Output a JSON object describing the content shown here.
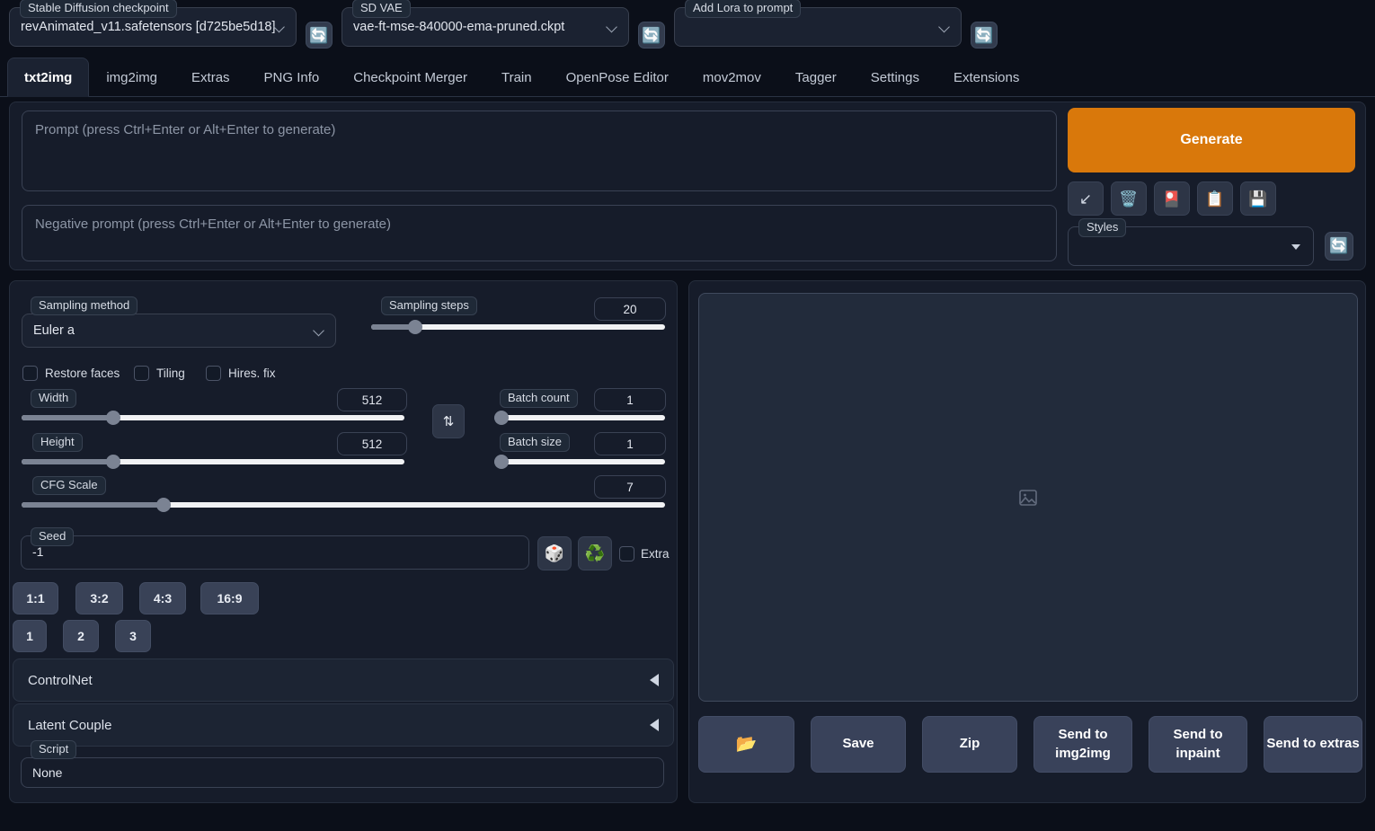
{
  "topbar": {
    "checkpoint": {
      "label": "Stable Diffusion checkpoint",
      "value": "revAnimated_v11.safetensors [d725be5d18]"
    },
    "vae": {
      "label": "SD VAE",
      "value": "vae-ft-mse-840000-ema-pruned.ckpt"
    },
    "lora": {
      "label": "Add Lora to prompt",
      "value": ""
    },
    "refresh_icon": "🔄"
  },
  "tabs": [
    {
      "label": "txt2img",
      "active": true
    },
    {
      "label": "img2img",
      "active": false
    },
    {
      "label": "Extras",
      "active": false
    },
    {
      "label": "PNG Info",
      "active": false
    },
    {
      "label": "Checkpoint Merger",
      "active": false
    },
    {
      "label": "Train",
      "active": false
    },
    {
      "label": "OpenPose Editor",
      "active": false
    },
    {
      "label": "mov2mov",
      "active": false
    },
    {
      "label": "Tagger",
      "active": false
    },
    {
      "label": "Settings",
      "active": false
    },
    {
      "label": "Extensions",
      "active": false
    }
  ],
  "prompt": {
    "value": "",
    "placeholder": "Prompt (press Ctrl+Enter or Alt+Enter to generate)"
  },
  "negative_prompt": {
    "value": "",
    "placeholder": "Negative prompt (press Ctrl+Enter or Alt+Enter to generate)"
  },
  "generate": {
    "label": "Generate",
    "color": "#d9780b"
  },
  "tool_buttons": [
    {
      "name": "restore-progress",
      "icon": "↙"
    },
    {
      "name": "clear-prompt",
      "icon": "🗑️"
    },
    {
      "name": "show-extra-networks",
      "icon": "🎴"
    },
    {
      "name": "apply-style",
      "icon": "📋"
    },
    {
      "name": "save-style",
      "icon": "💾"
    }
  ],
  "styles": {
    "label": "Styles",
    "value": "",
    "refresh_icon": "🔄"
  },
  "settings": {
    "sampling_method": {
      "label": "Sampling method",
      "value": "Euler a"
    },
    "sampling_steps": {
      "label": "Sampling steps",
      "value": "20",
      "min": 1,
      "max": 150,
      "percent": 13
    },
    "restore_faces": {
      "label": "Restore faces",
      "checked": false
    },
    "tiling": {
      "label": "Tiling",
      "checked": false
    },
    "hires_fix": {
      "label": "Hires. fix",
      "checked": false
    },
    "width": {
      "label": "Width",
      "value": "512",
      "min": 64,
      "max": 2048,
      "percent": 24
    },
    "height": {
      "label": "Height",
      "value": "512",
      "min": 64,
      "max": 2048,
      "percent": 24
    },
    "cfg_scale": {
      "label": "CFG Scale",
      "value": "7",
      "min": 1,
      "max": 30,
      "percent": 22
    },
    "batch_count": {
      "label": "Batch count",
      "value": "1",
      "min": 1,
      "max": 100,
      "percent": 1
    },
    "batch_size": {
      "label": "Batch size",
      "value": "1",
      "min": 1,
      "max": 8,
      "percent": 1
    },
    "swap_icon": "⇅",
    "seed": {
      "label": "Seed",
      "value": "-1"
    },
    "seed_random_icon": "🎲",
    "seed_recycle_icon": "♻️",
    "extra": {
      "label": "Extra",
      "checked": false
    }
  },
  "ratio_buttons": [
    "1:1",
    "3:2",
    "4:3",
    "16:9"
  ],
  "count_buttons": [
    "1",
    "2",
    "3"
  ],
  "accordions": [
    {
      "label": "ControlNet"
    },
    {
      "label": "Latent Couple"
    }
  ],
  "script": {
    "label": "Script",
    "value": "None"
  },
  "output": {
    "placeholder_icon": "image-placeholder",
    "buttons": [
      {
        "name": "open-folder",
        "label": "📂"
      },
      {
        "name": "save",
        "label": "Save"
      },
      {
        "name": "zip",
        "label": "Zip"
      },
      {
        "name": "send-to-img2img",
        "label": "Send to img2img"
      },
      {
        "name": "send-to-inpaint",
        "label": "Send to inpaint"
      },
      {
        "name": "send-to-extras",
        "label": "Send to extras"
      }
    ]
  }
}
